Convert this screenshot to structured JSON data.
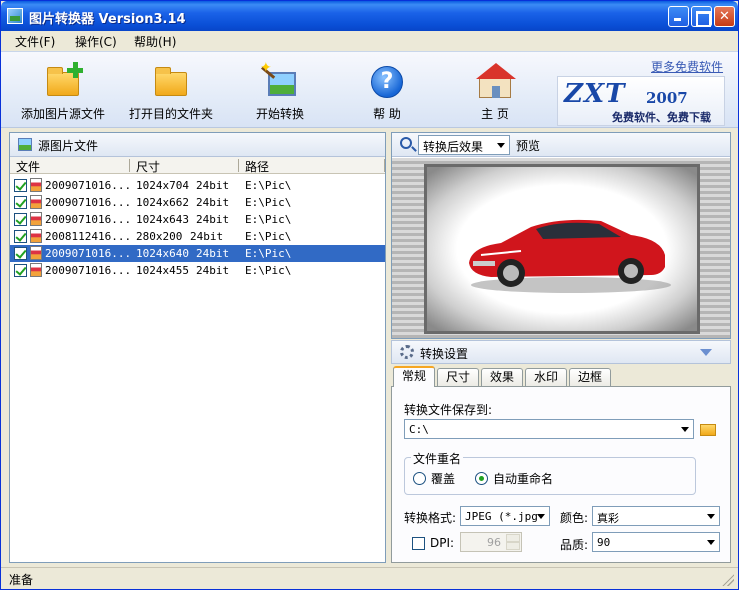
{
  "window": {
    "title": "图片转换器 Version3.14"
  },
  "menu": {
    "file": "文件(F)",
    "operate": "操作(C)",
    "help": "帮助(H)"
  },
  "toolbar": {
    "add_source": "添加图片源文件",
    "open_dest": "打开目的文件夹",
    "start_convert": "开始转换",
    "help": "帮 助",
    "home": "主 页"
  },
  "header_link": "更多免费软件",
  "logo": {
    "brand": "ZXT",
    "year": "2007",
    "tagline": "免费软件、免费下载"
  },
  "source_panel": {
    "title": "源图片文件",
    "columns": [
      "文件",
      "尺寸",
      "路径"
    ],
    "rows": [
      {
        "name": "2009071016...",
        "size": "1024x704",
        "depth": "24bit",
        "path": "E:\\Pic\\"
      },
      {
        "name": "2009071016...",
        "size": "1024x662",
        "depth": "24bit",
        "path": "E:\\Pic\\"
      },
      {
        "name": "2009071016...",
        "size": "1024x643",
        "depth": "24bit",
        "path": "E:\\Pic\\"
      },
      {
        "name": "2008112416...",
        "size": "280x200",
        "depth": "24bit",
        "path": "E:\\Pic\\"
      },
      {
        "name": "2009071016...",
        "size": "1024x640",
        "depth": "24bit",
        "path": "E:\\Pic\\"
      },
      {
        "name": "2009071016...",
        "size": "1024x455",
        "depth": "24bit",
        "path": "E:\\Pic\\"
      }
    ],
    "selected_index": 4
  },
  "preview_panel": {
    "mode": "转换后效果",
    "label": "预览"
  },
  "settings": {
    "title": "转换设置",
    "tabs": [
      "常规",
      "尺寸",
      "效果",
      "水印",
      "边框"
    ],
    "active_tab": "常规",
    "save_to_label": "转换文件保存到:",
    "save_to_value": "C:\\",
    "rename_group": "文件重名",
    "rename_options": [
      "覆盖",
      "自动重命名"
    ],
    "rename_selected": "自动重命名",
    "format_label": "转换格式:",
    "format_value": "JPEG (*.jpg",
    "color_label": "颜色:",
    "color_value": "真彩",
    "dpi_label": "DPI:",
    "dpi_value": "96",
    "quality_label": "品质:",
    "quality_value": "90"
  },
  "status": {
    "text": "准备"
  }
}
